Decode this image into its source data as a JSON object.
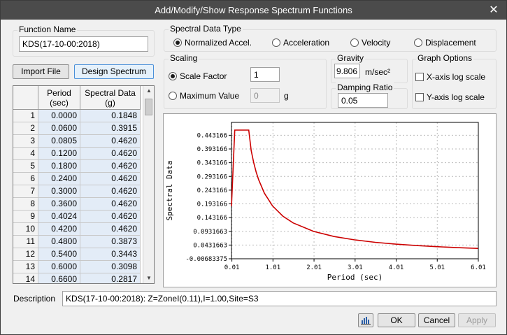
{
  "window": {
    "title": "Add/Modify/Show Response Spectrum Functions",
    "close_glyph": "✕"
  },
  "function_name": {
    "label": "Function Name",
    "value": "KDS(17-10-00:2018)"
  },
  "buttons": {
    "import_file": "Import File",
    "design_spectrum": "Design Spectrum",
    "ok": "OK",
    "cancel": "Cancel",
    "apply": "Apply"
  },
  "table": {
    "headers": {
      "period": "Period\n(sec)",
      "spectral": "Spectral Data\n(g)"
    },
    "rows": [
      {
        "i": "1",
        "period": "0.0000",
        "value": "0.1848"
      },
      {
        "i": "2",
        "period": "0.0600",
        "value": "0.3915"
      },
      {
        "i": "3",
        "period": "0.0805",
        "value": "0.4620"
      },
      {
        "i": "4",
        "period": "0.1200",
        "value": "0.4620"
      },
      {
        "i": "5",
        "period": "0.1800",
        "value": "0.4620"
      },
      {
        "i": "6",
        "period": "0.2400",
        "value": "0.4620"
      },
      {
        "i": "7",
        "period": "0.3000",
        "value": "0.4620"
      },
      {
        "i": "8",
        "period": "0.3600",
        "value": "0.4620"
      },
      {
        "i": "9",
        "period": "0.4024",
        "value": "0.4620"
      },
      {
        "i": "10",
        "period": "0.4200",
        "value": "0.4620"
      },
      {
        "i": "11",
        "period": "0.4800",
        "value": "0.3873"
      },
      {
        "i": "12",
        "period": "0.5400",
        "value": "0.3443"
      },
      {
        "i": "13",
        "period": "0.6000",
        "value": "0.3098"
      },
      {
        "i": "14",
        "period": "0.6600",
        "value": "0.2817"
      }
    ]
  },
  "spectral_data_type": {
    "label": "Spectral Data Type",
    "options": [
      "Normalized Accel.",
      "Acceleration",
      "Velocity",
      "Displacement"
    ],
    "selected": "Normalized Accel."
  },
  "scaling": {
    "label": "Scaling",
    "scale_factor_label": "Scale Factor",
    "scale_factor_value": "1",
    "max_value_label": "Maximum Value",
    "max_value_value": "0",
    "max_value_unit": "g",
    "selected": "Scale Factor"
  },
  "gravity": {
    "label": "Gravity",
    "value": "9.806",
    "unit": "m/sec²"
  },
  "damping": {
    "label": "Damping Ratio",
    "value": "0.05"
  },
  "graph_options": {
    "label": "Graph Options",
    "x_log": "X-axis log scale",
    "y_log": "Y-axis log scale",
    "x_log_checked": false,
    "y_log_checked": false
  },
  "description": {
    "label": "Description",
    "value": "KDS(17-10-00:2018): Z=ZoneI(0.11),I=1.00,Site=S3"
  },
  "chart_data": {
    "type": "line",
    "xlabel": "Period (sec)",
    "ylabel": "Spectral Data",
    "xlim": [
      0.01,
      6.01
    ],
    "ylim": [
      -0.00683375,
      0.49
    ],
    "xticks": [
      "0.01",
      "1.01",
      "2.01",
      "3.01",
      "4.01",
      "5.01",
      "6.01"
    ],
    "xtick_values": [
      0.01,
      1.01,
      2.01,
      3.01,
      4.01,
      5.01,
      6.01
    ],
    "yticks": [
      "0.443166",
      "0.393166",
      "0.343166",
      "0.293166",
      "0.243166",
      "0.193166",
      "0.143166",
      "0.0931663",
      "0.0431663",
      "-0.00683375"
    ],
    "ytick_values": [
      0.443166,
      0.393166,
      0.343166,
      0.293166,
      0.243166,
      0.193166,
      0.143166,
      0.0931663,
      0.0431663,
      -0.00683375
    ],
    "grid": true,
    "line_color": "#cc0000",
    "x": [
      0.0,
      0.06,
      0.0805,
      0.12,
      0.18,
      0.24,
      0.3,
      0.36,
      0.4024,
      0.42,
      0.48,
      0.54,
      0.6,
      0.66,
      0.8,
      1.0,
      1.25,
      1.5,
      2.0,
      2.5,
      3.0,
      3.5,
      4.0,
      4.5,
      5.0,
      5.5,
      6.0
    ],
    "y": [
      0.1848,
      0.3915,
      0.462,
      0.462,
      0.462,
      0.462,
      0.462,
      0.462,
      0.462,
      0.462,
      0.3873,
      0.3443,
      0.3098,
      0.2817,
      0.2324,
      0.1859,
      0.1487,
      0.1239,
      0.0929,
      0.0743,
      0.062,
      0.0531,
      0.0465,
      0.0413,
      0.0372,
      0.0338,
      0.031
    ]
  }
}
